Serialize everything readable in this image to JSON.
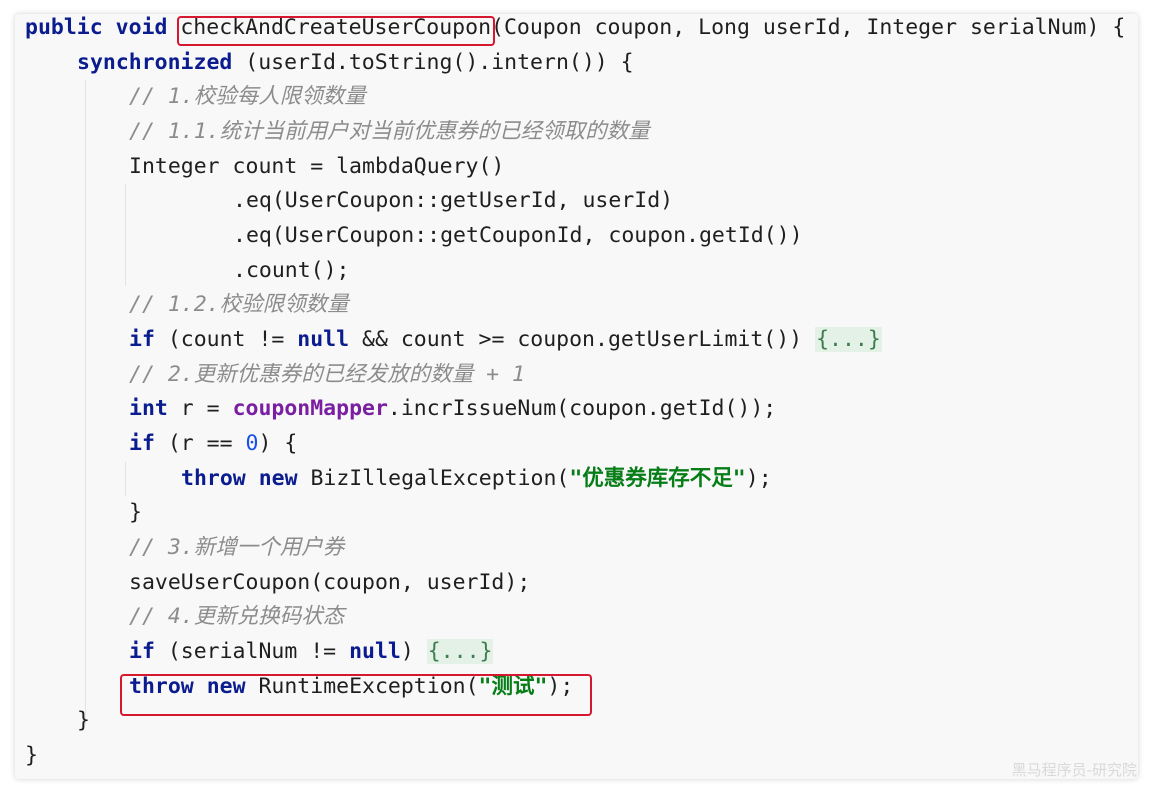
{
  "code": {
    "sig_public": "public",
    "sig_void": "void",
    "method_name": "checkAndCreateUserCoupon",
    "sig_params": "(Coupon coupon, Long userId, Integer serialNum) {",
    "sync_kw": "synchronized",
    "sync_rest": " (userId.toString().intern()) {",
    "c1": "// 1.校验每人限领数量",
    "c11": "// 1.1.统计当前用户对当前优惠券的已经领取的数量",
    "count_decl": "Integer count = lambdaQuery()",
    "eq1": ".eq(UserCoupon::getUserId, userId)",
    "eq2": ".eq(UserCoupon::getCouponId, coupon.getId())",
    "count_call": ".count();",
    "c12": "// 1.2.校验限领数量",
    "if_kw": "if",
    "if1_a": " (count != ",
    "null_kw": "null",
    "if1_b": " && count >= coupon.getUserLimit()) ",
    "fold": "{...}",
    "c2": "// 2.更新优惠券的已经发放的数量 + 1",
    "int_kw": "int",
    "int_a": " r = ",
    "mapper": "couponMapper",
    "int_b": ".incrIssueNum(coupon.getId());",
    "if2_a": " (r == ",
    "zero": "0",
    "if2_b": ") {",
    "throw_kw": "throw",
    "new_kw": "new",
    "throw1_a": " BizIllegalException(",
    "throw1_str": "\"优惠券库存不足\"",
    "close_stmt": ");",
    "brace": "}",
    "c3": "// 3.新增一个用户券",
    "save_call": "saveUserCoupon(coupon, userId);",
    "c4": "// 4.更新兑换码状态",
    "if3_a": " (serialNum != ",
    "if3_b": ") ",
    "throw2_a": " RuntimeException(",
    "throw2_str": "\"测试\""
  },
  "watermark": "黑马程序员-研究院"
}
